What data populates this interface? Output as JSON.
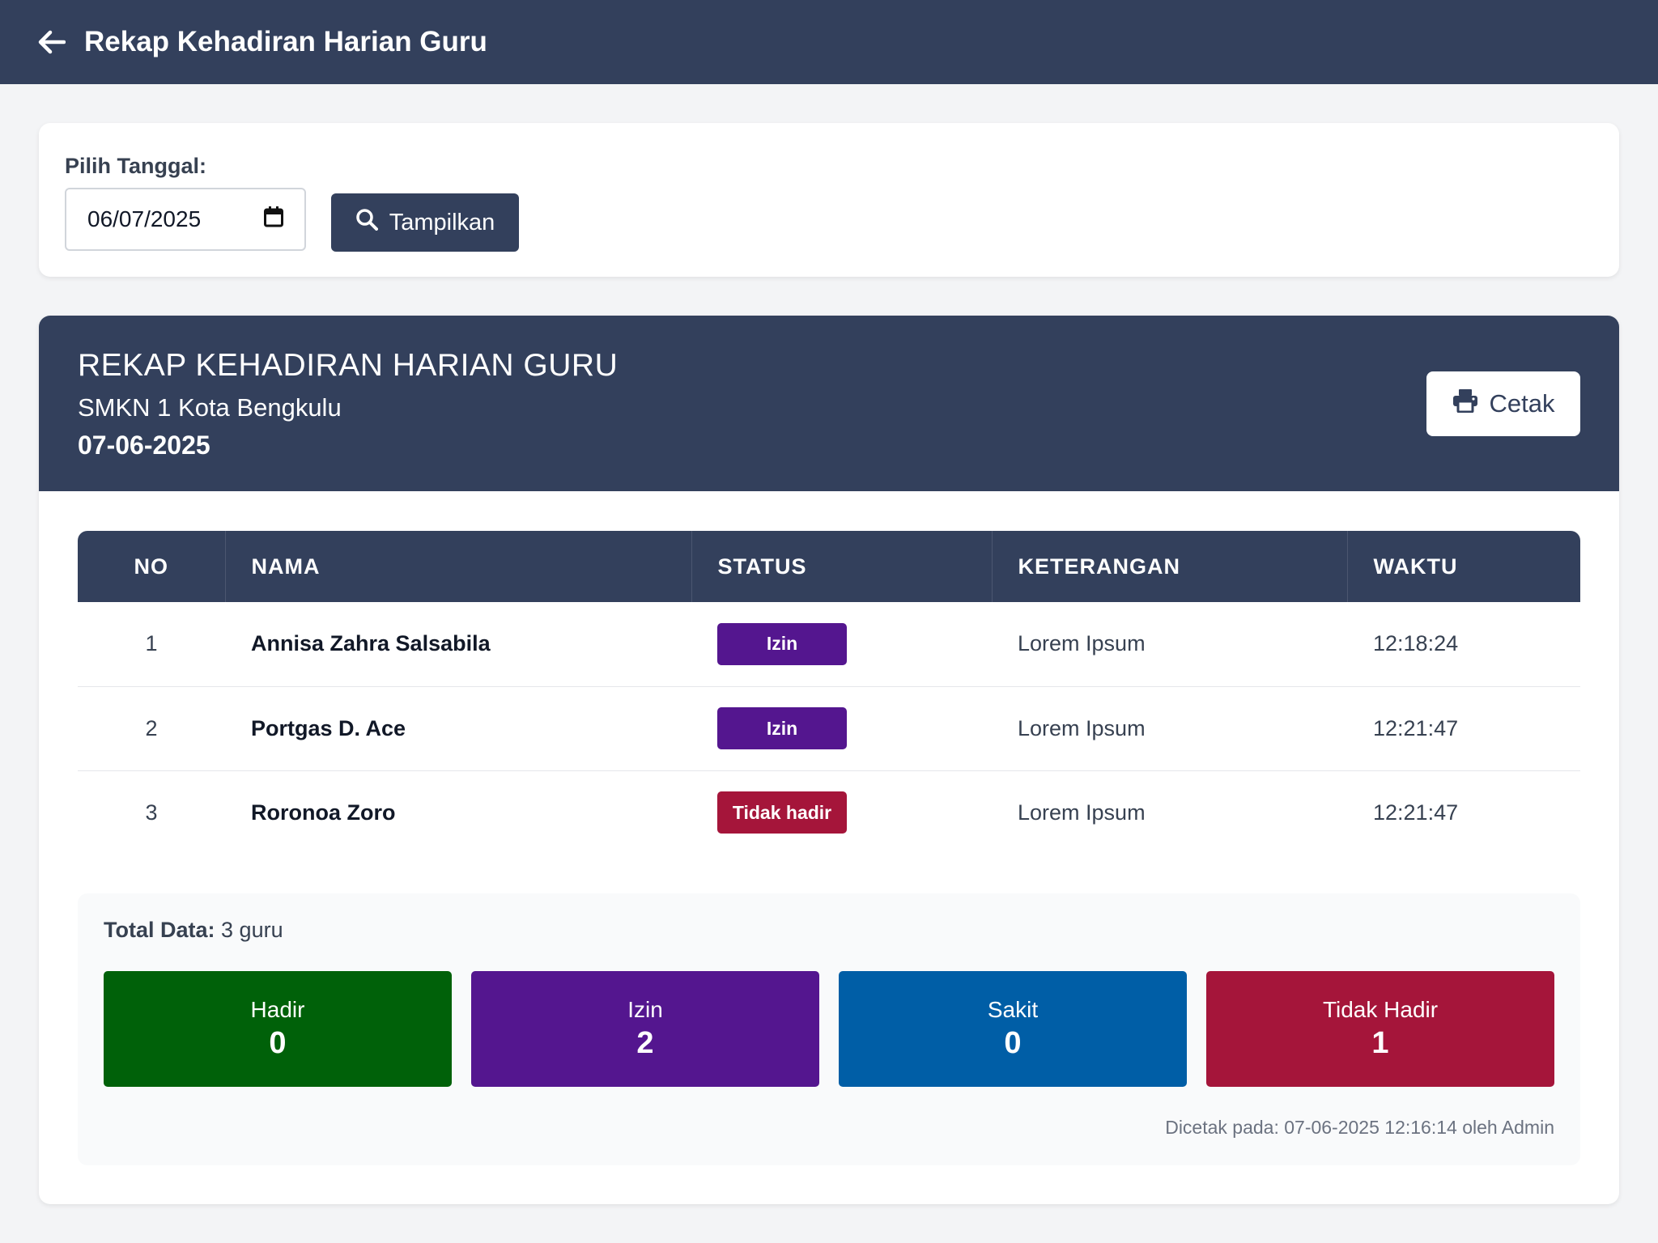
{
  "header": {
    "title": "Rekap Kehadiran Harian Guru",
    "back_icon": "arrow-left-icon"
  },
  "filter": {
    "label": "Pilih Tanggal:",
    "date_value": "06/07/2025",
    "button_label": "Tampilkan"
  },
  "report": {
    "title": "REKAP KEHADIRAN HARIAN GURU",
    "school": "SMKN 1 Kota Bengkulu",
    "date": "07-06-2025",
    "print_label": "Cetak",
    "columns": {
      "no": "NO",
      "nama": "NAMA",
      "status": "STATUS",
      "keterangan": "KETERANGAN",
      "waktu": "WAKTU"
    },
    "rows": [
      {
        "no": "1",
        "nama": "Annisa Zahra Salsabila",
        "status": "Izin",
        "keterangan": "Lorem Ipsum",
        "waktu": "12:18:24"
      },
      {
        "no": "2",
        "nama": "Portgas D. Ace",
        "status": "Izin",
        "keterangan": "Lorem Ipsum",
        "waktu": "12:21:47"
      },
      {
        "no": "3",
        "nama": "Roronoa Zoro",
        "status": "Tidak hadir",
        "keterangan": "Lorem Ipsum",
        "waktu": "12:21:47"
      }
    ]
  },
  "summary": {
    "total_label": "Total Data:",
    "total_value": "3 guru",
    "stats": [
      {
        "label": "Hadir",
        "value": "0"
      },
      {
        "label": "Izin",
        "value": "2"
      },
      {
        "label": "Sakit",
        "value": "0"
      },
      {
        "label": "Tidak Hadir",
        "value": "1"
      }
    ],
    "printed_info": "Dicetak pada: 07-06-2025 12:16:14 oleh Admin"
  },
  "colors": {
    "primary": "#33405c",
    "izin": "#54168f",
    "tidak_hadir": "#a5153a",
    "hadir": "#006109",
    "sakit": "#005ea6"
  }
}
